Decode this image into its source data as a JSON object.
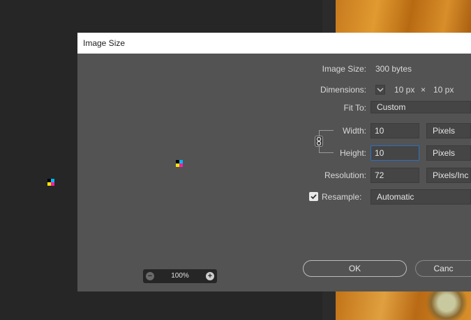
{
  "dialog": {
    "title": "Image Size",
    "zoom_label": "100%",
    "image_size": {
      "label": "Image Size:",
      "value": "300 bytes"
    },
    "dimensions": {
      "label": "Dimensions:",
      "width_value": "10 px",
      "times": "×",
      "height_value": "10 px"
    },
    "fit_to": {
      "label": "Fit To:",
      "value": "Custom"
    },
    "width": {
      "label": "Width:",
      "value": "10",
      "unit": "Pixels"
    },
    "height": {
      "label": "Height:",
      "value": "10",
      "unit": "Pixels"
    },
    "resolution": {
      "label": "Resolution:",
      "value": "72",
      "unit": "Pixels/Inc"
    },
    "resample": {
      "label": "Resample:",
      "checked": true,
      "value": "Automatic"
    },
    "buttons": {
      "ok": "OK",
      "cancel": "Canc"
    }
  },
  "colors": {
    "dialog_bg": "#535353",
    "workspace_bg": "#262626",
    "focus_accent": "#2b6fc4"
  }
}
